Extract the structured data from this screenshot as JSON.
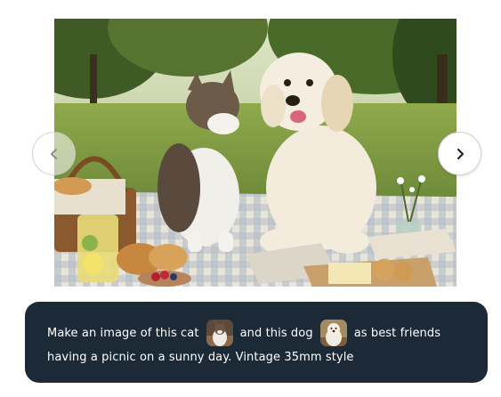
{
  "image": {
    "alt": "A cat and a fluffy white dog sitting on a picnic blanket in a sunny park"
  },
  "carousel": {
    "prev_icon": "chevron-left-icon",
    "next_icon": "chevron-right-icon"
  },
  "prompt": {
    "part1": "Make an image of this cat",
    "part2": "and this dog",
    "part3": "as best friends",
    "line2": "having a picnic on a sunny day. Vintage 35mm style",
    "cat_thumb_icon": "cat-photo-thumbnail",
    "dog_thumb_icon": "dog-photo-thumbnail"
  },
  "colors": {
    "prompt_bg": "#1c2a38",
    "prompt_text": "#ffffff"
  }
}
